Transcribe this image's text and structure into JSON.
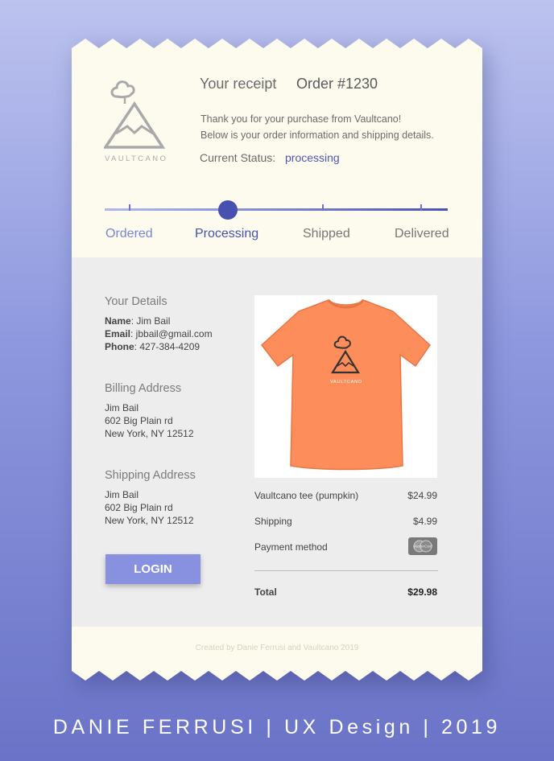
{
  "brand": {
    "logo_text": "VAULTCANO"
  },
  "header": {
    "title": "Your receipt",
    "order": "Order #1230",
    "thanks": "Thank you for your purchase from Vaultcano!",
    "info": "Below is your order information and shipping details.",
    "status_label": "Current Status:",
    "status_value": "processing"
  },
  "progress": {
    "steps": [
      "Ordered",
      "Processing",
      "Shipped",
      "Delivered"
    ],
    "current": "Processing"
  },
  "details": {
    "title": "Your Details",
    "name_label": "Name",
    "name": ": Jim Bail",
    "email_label": "Email",
    "email": ": jbbail@gmail.com",
    "phone_label": "Phone",
    "phone": ": 427-384-4209"
  },
  "billing": {
    "title": "Billing Address",
    "lines": [
      "Jim Bail",
      "602 Big Plain rd",
      "New York, NY 12512"
    ]
  },
  "shipping_address": {
    "title": "Shipping Address",
    "lines": [
      "Jim Bail",
      "602 Big Plain rd",
      "New York, NY 12512"
    ]
  },
  "login_label": "LOGIN",
  "product": {
    "image_text": "VAULTCANO",
    "name": "Vaultcano tee (pumpkin)",
    "price": "$24.99",
    "shirt_color": "#fd8d5a"
  },
  "summary": {
    "shipping_label": "Shipping",
    "shipping_value": "$4.99",
    "payment_label": "Payment method",
    "payment_icon": "mastercard-icon",
    "card_text": "MasterCard",
    "total_label": "Total",
    "total_value": "$29.98"
  },
  "footer": {
    "note": "Created by Danie Ferrusi and Vaultcano 2019"
  },
  "banner": {
    "text": "DANIE FERRUSI | UX Design | 2019"
  },
  "colors": {
    "accent": "#4a52b4",
    "light_accent": "#8791df",
    "paper": "#fdfbee",
    "panel": "#ededed"
  }
}
